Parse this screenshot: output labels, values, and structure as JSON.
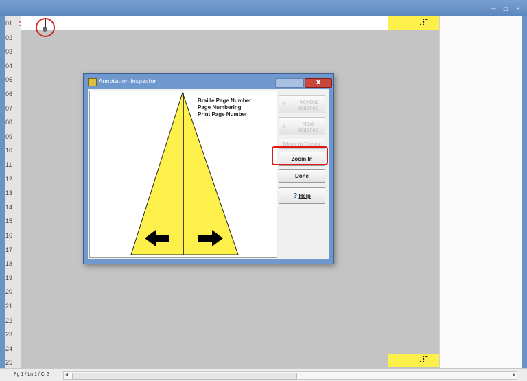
{
  "window": {
    "min_glyph": "—",
    "max_glyph": "□",
    "close_glyph": "✕"
  },
  "gutter": {
    "line_numbers": [
      "01",
      "02",
      "03",
      "04",
      "05",
      "06",
      "07",
      "08",
      "09",
      "10",
      "11",
      "12",
      "13",
      "14",
      "15",
      "16",
      "17",
      "18",
      "19",
      "20",
      "21",
      "22",
      "23",
      "24",
      "25"
    ]
  },
  "braille": {
    "top_cell": "⠼⠁",
    "bottom_cell": "⠼⠁"
  },
  "dialog": {
    "title": "Annotation Inspector",
    "close_glyph": "X",
    "annotations": [
      "Braille Page Number",
      "Page Numbering",
      "Print Page Number"
    ],
    "buttons": {
      "previous_instance": {
        "line1": "Previous",
        "line2": "Instance",
        "arrow": "⇧"
      },
      "next_instance": {
        "line1": "Next",
        "line2": "Instance",
        "arrow": "⇩"
      },
      "move_to_cursor": "Move to Cursor",
      "zoom_in": "Zoom In",
      "done": "Done",
      "help_q": "?",
      "help": "Help"
    }
  },
  "status": {
    "position": "Pg 1 / Ln 1 / Cl 3"
  },
  "colors": {
    "highlight": "#fef04a",
    "callout": "#e01818",
    "document_bg": "#c4c4c4"
  }
}
